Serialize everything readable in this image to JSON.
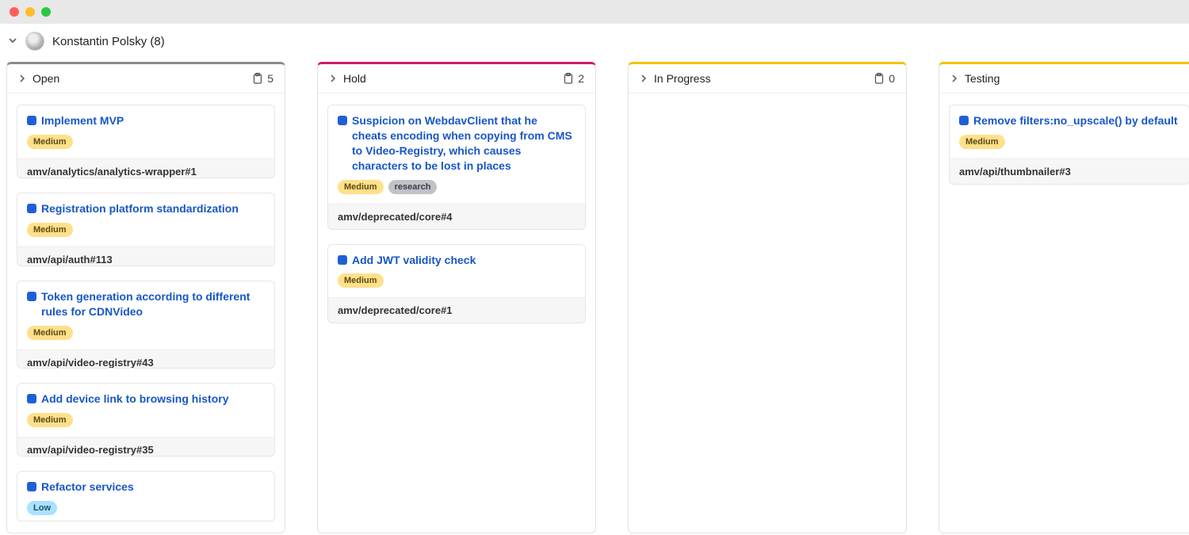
{
  "user": {
    "name_with_count": "Konstantin Polsky (8)"
  },
  "columns": [
    {
      "title": "Open",
      "count": "5",
      "accent": "#8a8a8a",
      "cards": [
        {
          "title": "Implement MVP",
          "labels": [
            {
              "text": "Medium",
              "cls": "badge-medium"
            }
          ],
          "ref": "amv/analytics/analytics-wrapper#1"
        },
        {
          "title": "Registration platform standardization",
          "labels": [
            {
              "text": "Medium",
              "cls": "badge-medium"
            }
          ],
          "ref": "amv/api/auth#113"
        },
        {
          "title": "Token generation according to different rules for CDNVideo",
          "labels": [
            {
              "text": "Medium",
              "cls": "badge-medium"
            }
          ],
          "ref": "amv/api/video-registry#43"
        },
        {
          "title": "Add device link to browsing history",
          "labels": [
            {
              "text": "Medium",
              "cls": "badge-medium"
            }
          ],
          "ref": "amv/api/video-registry#35"
        },
        {
          "title": "Refactor services",
          "labels": [
            {
              "text": "Low",
              "cls": "badge-low"
            }
          ],
          "ref": ""
        }
      ]
    },
    {
      "title": "Hold",
      "count": "2",
      "accent": "#d11a63",
      "cards": [
        {
          "title": "Suspicion on WebdavClient that he cheats encoding when copying from CMS to Video-Registry, which causes characters to be lost in places",
          "labels": [
            {
              "text": "Medium",
              "cls": "badge-medium"
            },
            {
              "text": "research",
              "cls": "badge-research"
            }
          ],
          "ref": "amv/deprecated/core#4"
        },
        {
          "title": "Add JWT validity check",
          "labels": [
            {
              "text": "Medium",
              "cls": "badge-medium"
            }
          ],
          "ref": "amv/deprecated/core#1"
        }
      ]
    },
    {
      "title": "In Progress",
      "count": "0",
      "accent": "#f2c300",
      "cards": []
    },
    {
      "title": "Testing",
      "count": "",
      "accent": "#f2c300",
      "cards": [
        {
          "title": "Remove filters:no_upscale() by default",
          "labels": [
            {
              "text": "Medium",
              "cls": "badge-medium"
            }
          ],
          "ref": "amv/api/thumbnailer#3"
        }
      ]
    }
  ]
}
